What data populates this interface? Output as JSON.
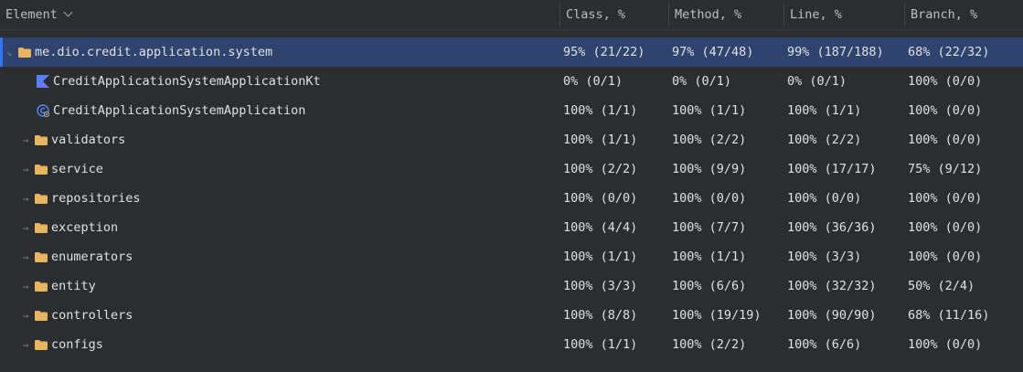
{
  "header": {
    "element": "Element",
    "class": "Class, %",
    "method": "Method, %",
    "line": "Line, %",
    "branch": "Branch, %"
  },
  "rows": [
    {
      "name": "me.dio.credit.application.system",
      "icon": "folder-icon",
      "expanded": true,
      "class": "95% (21/22)",
      "method": "97% (47/48)",
      "line": "99% (187/188)",
      "branch": "68% (22/32)"
    },
    {
      "name": "CreditApplicationSystemApplicationKt",
      "icon": "kotlin-file-icon",
      "class": "0% (0/1)",
      "method": "0% (0/1)",
      "line": "0% (0/1)",
      "branch": "100% (0/0)"
    },
    {
      "name": "CreditApplicationSystemApplication",
      "icon": "class-icon",
      "class": "100% (1/1)",
      "method": "100% (1/1)",
      "line": "100% (1/1)",
      "branch": "100% (0/0)"
    },
    {
      "name": "validators",
      "icon": "folder-icon",
      "class": "100% (1/1)",
      "method": "100% (2/2)",
      "line": "100% (2/2)",
      "branch": "100% (0/0)"
    },
    {
      "name": "service",
      "icon": "folder-icon",
      "class": "100% (2/2)",
      "method": "100% (9/9)",
      "line": "100% (17/17)",
      "branch": "75% (9/12)"
    },
    {
      "name": "repositories",
      "icon": "folder-icon",
      "class": "100% (0/0)",
      "method": "100% (0/0)",
      "line": "100% (0/0)",
      "branch": "100% (0/0)"
    },
    {
      "name": "exception",
      "icon": "folder-icon",
      "class": "100% (4/4)",
      "method": "100% (7/7)",
      "line": "100% (36/36)",
      "branch": "100% (0/0)"
    },
    {
      "name": "enumerators",
      "icon": "folder-icon",
      "class": "100% (1/1)",
      "method": "100% (1/1)",
      "line": "100% (3/3)",
      "branch": "100% (0/0)"
    },
    {
      "name": "entity",
      "icon": "folder-icon",
      "class": "100% (3/3)",
      "method": "100% (6/6)",
      "line": "100% (32/32)",
      "branch": "50% (2/4)"
    },
    {
      "name": "controllers",
      "icon": "folder-icon",
      "class": "100% (8/8)",
      "method": "100% (19/19)",
      "line": "100% (90/90)",
      "branch": "68% (11/16)"
    },
    {
      "name": "configs",
      "icon": "folder-icon",
      "class": "100% (1/1)",
      "method": "100% (2/2)",
      "line": "100% (6/6)",
      "branch": "100% (0/0)"
    }
  ],
  "colors": {
    "background": "#2b2d30",
    "selection": "#2e436e",
    "accent": "#3574f0",
    "folder": "#e8b55e",
    "kotlin": "#7f6bf0"
  }
}
